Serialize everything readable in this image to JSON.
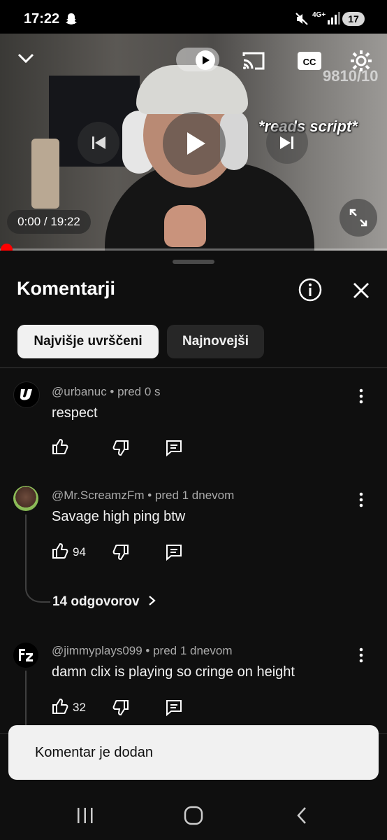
{
  "status_bar": {
    "time": "17:22",
    "network": "4G+",
    "battery": "17"
  },
  "video": {
    "time_display": "0:00 / 19:22",
    "overlay_text": "*reads script*",
    "score_text": "9810/10",
    "progress": 0.0
  },
  "comments_panel": {
    "title": "Komentarji",
    "sort_chips": [
      {
        "label": "Najvišje uvrščeni",
        "active": true
      },
      {
        "label": "Najnovejši",
        "active": false
      }
    ],
    "comments": [
      {
        "author": "@urbanuc",
        "time": "pred 0 s",
        "meta": "@urbanuc • pred 0 s",
        "text": "respect",
        "likes": ""
      },
      {
        "author": "@Mr.ScreamzFm",
        "time": "pred 1 dnevom",
        "meta": "@Mr.ScreamzFm • pred 1 dnevom",
        "text": "Savage high ping btw",
        "likes": "94",
        "replies_label": "14 odgovorov"
      },
      {
        "author": "@jimmyplays099",
        "time": "pred 1 dnevom",
        "meta": "@jimmyplays099 • pred 1 dnevom",
        "text": "damn clix is playing so cringe on height",
        "likes": "32"
      }
    ]
  },
  "toast": {
    "message": "Komentar je dodan"
  },
  "colors": {
    "background": "#0f0f0f",
    "progress": "#ff0000",
    "chip_active": "#f1f1f1",
    "chip_inactive": "#272727",
    "toast": "#f1f1f1"
  }
}
